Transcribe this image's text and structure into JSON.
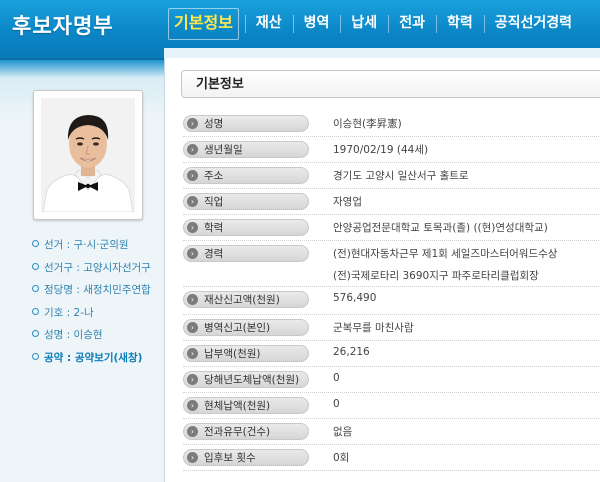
{
  "app_title": "후보자명부",
  "nav": {
    "items": [
      {
        "label": "기본정보",
        "active": true
      },
      {
        "label": "재산",
        "active": false
      },
      {
        "label": "병역",
        "active": false
      },
      {
        "label": "납세",
        "active": false
      },
      {
        "label": "전과",
        "active": false
      },
      {
        "label": "학력",
        "active": false
      },
      {
        "label": "공직선거경력",
        "active": false
      }
    ]
  },
  "sidebar": {
    "items": [
      {
        "label": "선거",
        "value": "구·시·군의원"
      },
      {
        "label": "선거구",
        "value": "고양시자선거구"
      },
      {
        "label": "정당명",
        "value": "새정치민주연합"
      },
      {
        "label": "기호",
        "value": "2-나"
      },
      {
        "label": "성명",
        "value": "이승현"
      },
      {
        "label": "공약",
        "value": "공약보기(새창)"
      }
    ]
  },
  "section": {
    "title": "기본정보"
  },
  "rows": [
    {
      "label": "성명",
      "lines": [
        "이승현(李昇憲)"
      ]
    },
    {
      "label": "생년월일",
      "lines": [
        "1970/02/19 (44세)"
      ]
    },
    {
      "label": "주소",
      "lines": [
        "경기도 고양시 일산서구 홀트로"
      ]
    },
    {
      "label": "직업",
      "lines": [
        "자영업"
      ]
    },
    {
      "label": "학력",
      "lines": [
        "안양공업전문대학교 토목과(졸) ((현)연성대학교)"
      ]
    },
    {
      "label": "경력",
      "lines": [
        "(전)현대자동차근무 제1회 세일즈마스터어워드수상",
        "(전)국제로타리 3690지구 파주로타리클럽회장"
      ]
    },
    {
      "label": "재산신고액(천원)",
      "lines": [
        "576,490"
      ]
    },
    {
      "label": "병역신고(본인)",
      "lines": [
        "군복무를 마친사람"
      ]
    },
    {
      "label": "납부액(천원)",
      "lines": [
        "26,216"
      ]
    },
    {
      "label": "당해년도체납액(천원)",
      "lines": [
        "0"
      ]
    },
    {
      "label": "현체납액(천원)",
      "lines": [
        "0"
      ]
    },
    {
      "label": "전과유무(건수)",
      "lines": [
        "없음"
      ]
    },
    {
      "label": "입후보 횟수",
      "lines": [
        "0회"
      ]
    }
  ],
  "colors": {
    "header": "#0b86c7",
    "active_nav": "#ffe94a",
    "sidebar_text": "#2f82ae"
  }
}
